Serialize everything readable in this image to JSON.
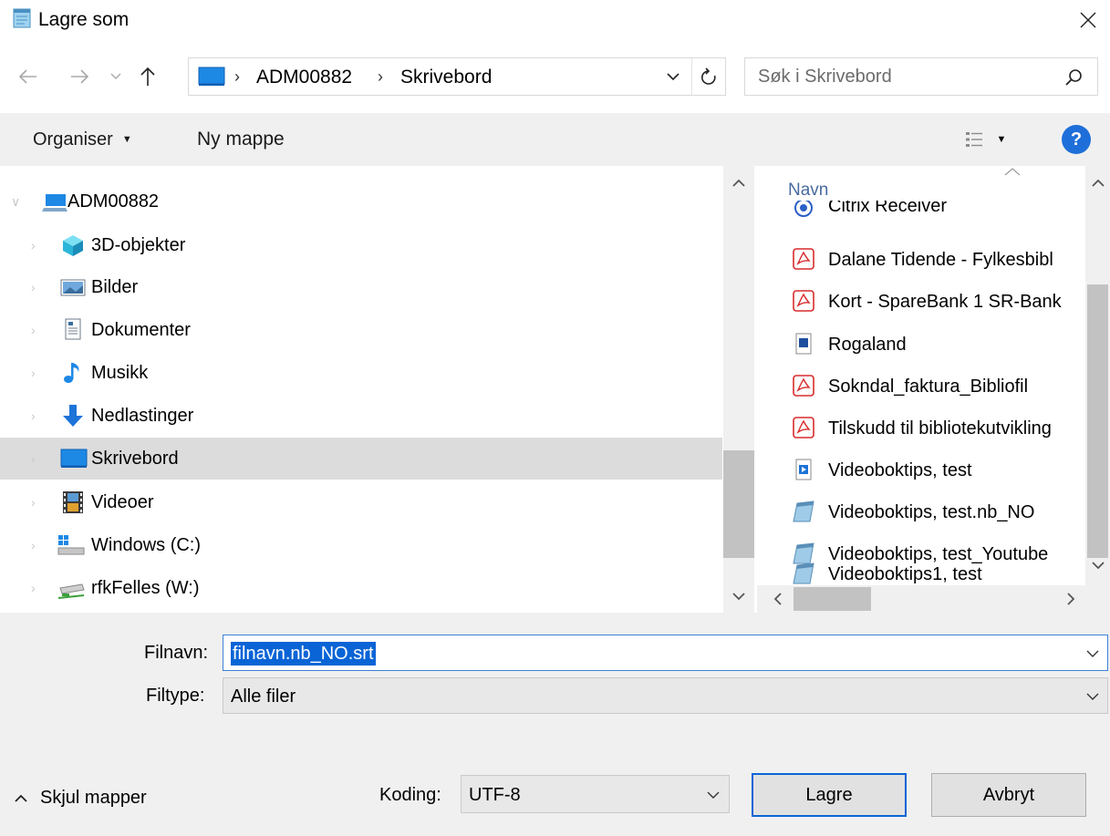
{
  "window": {
    "title": "Lagre som",
    "icon": "notepad-icon",
    "close_icon": "close-icon"
  },
  "navigation": {
    "back_icon": "arrow-left-icon",
    "forward_icon": "arrow-right-icon",
    "recent_icon": "chevron-down-icon",
    "up_icon": "arrow-up-icon"
  },
  "address_bar": {
    "crumbs": [
      "ADM00882",
      "Skrivebord"
    ],
    "dropdown_icon": "chevron-down-icon",
    "refresh_icon": "refresh-icon"
  },
  "search": {
    "placeholder": "Søk i Skrivebord",
    "value": ""
  },
  "toolbar": {
    "organise_label": "Organiser",
    "new_folder_label": "Ny mappe",
    "view_icon": "view-list-icon",
    "help_label": "?"
  },
  "tree": {
    "root": {
      "label": "ADM00882",
      "icon": "computer-icon",
      "expanded": true
    },
    "items": [
      {
        "label": "3D-objekter",
        "icon": "cube-3d-icon"
      },
      {
        "label": "Bilder",
        "icon": "pictures-icon"
      },
      {
        "label": "Dokumenter",
        "icon": "documents-icon"
      },
      {
        "label": "Musikk",
        "icon": "music-note-icon"
      },
      {
        "label": "Nedlastinger",
        "icon": "download-arrow-icon"
      },
      {
        "label": "Skrivebord",
        "icon": "desktop-icon",
        "selected": true
      },
      {
        "label": "Videoer",
        "icon": "film-icon"
      },
      {
        "label": "Windows (C:)",
        "icon": "windows-drive-icon"
      },
      {
        "label": "rfkFelles (W:)",
        "icon": "network-drive-icon"
      }
    ]
  },
  "files": {
    "column_header": "Navn",
    "items": [
      {
        "label": "Citrix Receiver",
        "icon": "citrix-icon"
      },
      {
        "label": "Dalane Tidende - Fylkesbibl",
        "icon": "pdf-icon"
      },
      {
        "label": "Kort - SpareBank 1 SR-Bank",
        "icon": "pdf-icon"
      },
      {
        "label": "Rogaland",
        "icon": "image-file-icon"
      },
      {
        "label": "Sokndal_faktura_Bibliofil",
        "icon": "pdf-icon"
      },
      {
        "label": "Tilskudd til bibliotekutvikling",
        "icon": "pdf-icon"
      },
      {
        "label": "Videoboktips, test",
        "icon": "video-shortcut-icon"
      },
      {
        "label": "Videoboktips, test.nb_NO",
        "icon": "notepad-icon"
      },
      {
        "label": "Videoboktips, test_Youtube",
        "icon": "notepad-icon"
      },
      {
        "label": "Videoboktips1, test",
        "icon": "notepad-icon"
      }
    ]
  },
  "form": {
    "filename_label": "Filnavn:",
    "filename_value": "filnavn.nb_NO.srt",
    "filetype_label": "Filtype:",
    "filetype_value": "Alle filer",
    "encoding_label": "Koding:",
    "encoding_value": "UTF-8"
  },
  "footer": {
    "hide_folders_label": "Skjul mapper",
    "save_label": "Lagre",
    "cancel_label": "Avbryt"
  },
  "colors": {
    "accent": "#0a64d6",
    "toolbar_bg": "#f0f0f0",
    "selected_bg": "#dcdcdc",
    "pdf_red": "#d92b2b"
  }
}
